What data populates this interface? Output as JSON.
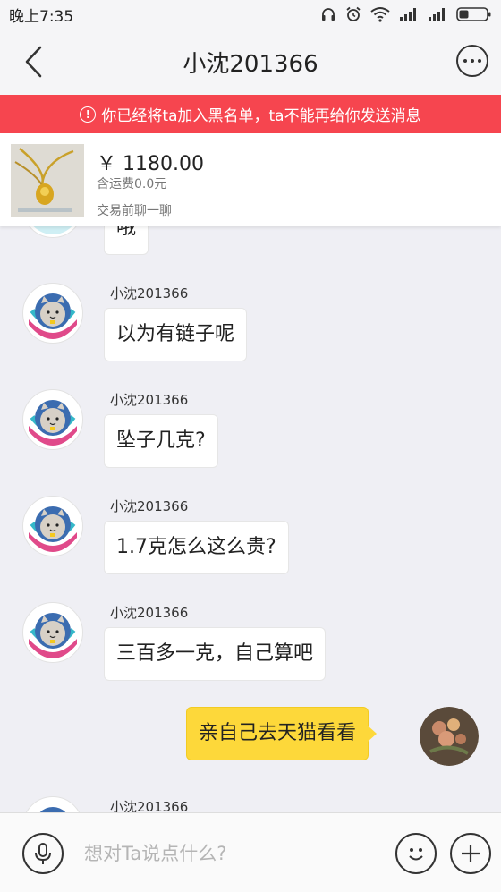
{
  "status_bar": {
    "time": "晚上7:35"
  },
  "header": {
    "title": "小沈201366"
  },
  "banner": {
    "icon": "warning-icon",
    "text": "你已经将ta加入黑名单，ta不能再给你发送消息"
  },
  "product": {
    "price": "￥ 1180.00",
    "shipping": "含运费0.0元",
    "chat_prompt": "交易前聊一聊"
  },
  "chat": {
    "partial_message": "哦",
    "messages": [
      {
        "sender": "小沈201366",
        "text": "以为有链子呢"
      },
      {
        "sender": "小沈201366",
        "text": "坠子几克?"
      },
      {
        "sender": "小沈201366",
        "text": "1.7克怎么这么贵?"
      },
      {
        "sender": "小沈201366",
        "text": "三百多一克，自己算吧"
      },
      {
        "sender": "me",
        "text": "亲自己去天猫看看"
      },
      {
        "sender": "小沈201366",
        "text": ""
      }
    ]
  },
  "input": {
    "placeholder": "想对Ta说点什么?"
  },
  "colors": {
    "banner": "#f6454f",
    "my_bubble": "#fdd83a"
  }
}
